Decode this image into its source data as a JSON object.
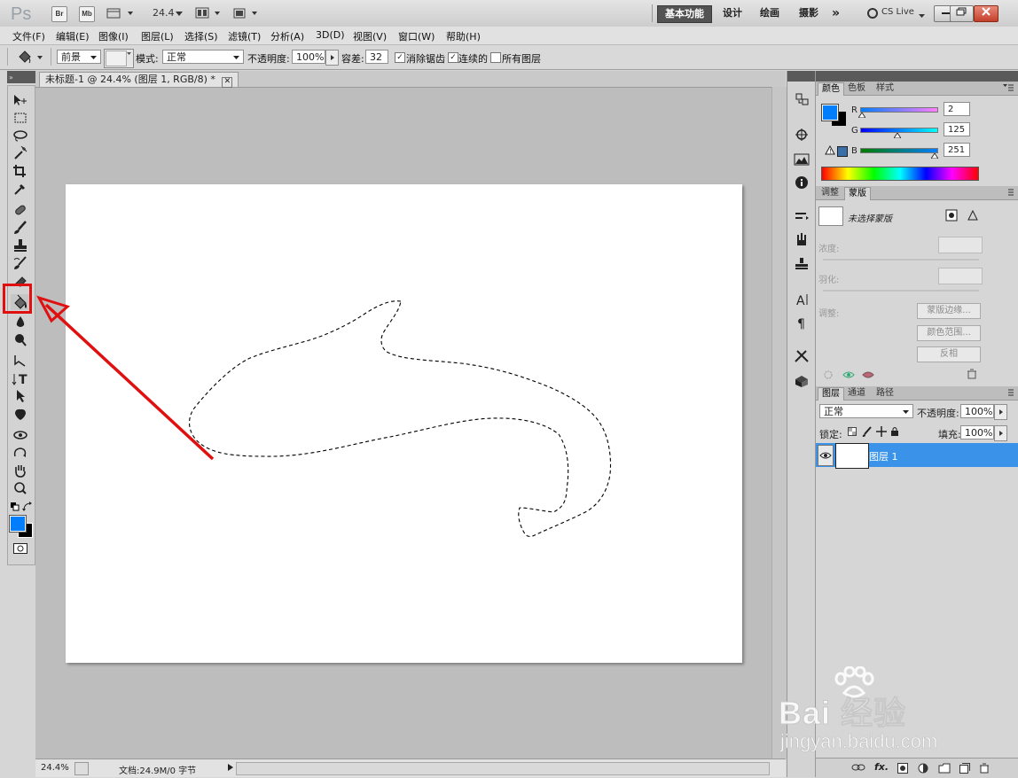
{
  "app": {
    "logo": "Ps",
    "bridge_btn": "Br",
    "mini_bridge_btn": "Mb",
    "zoom_value": "24.4",
    "workspaces": [
      "基本功能",
      "设计",
      "绘画",
      "摄影"
    ],
    "more_ws": "»",
    "cs_live": "CS Live"
  },
  "menu": [
    "文件(F)",
    "编辑(E)",
    "图像(I)",
    "图层(L)",
    "选择(S)",
    "滤镜(T)",
    "分析(A)",
    "3D(D)",
    "视图(V)",
    "窗口(W)",
    "帮助(H)"
  ],
  "options": {
    "fill_source": "前景",
    "mode_label": "模式:",
    "mode_value": "正常",
    "opacity_label": "不透明度:",
    "opacity_value": "100%",
    "tolerance_label": "容差:",
    "tolerance_value": "32",
    "antialias_label": "消除锯齿",
    "contiguous_label": "连续的",
    "all_layers_label": "所有图层"
  },
  "document": {
    "tab_title": "未标题-1 @ 24.4% (图层 1, RGB/8) *",
    "status_zoom": "24.4%",
    "status_doc": "文档:24.9M/0 字节"
  },
  "color_panel": {
    "tabs": [
      "颜色",
      "色板",
      "样式"
    ],
    "r_label": "R",
    "g_label": "G",
    "b_label": "B",
    "r": "2",
    "g": "125",
    "b": "251",
    "fg_color": "#027dfb"
  },
  "masks_panel": {
    "tabs": [
      "调整",
      "蒙版"
    ],
    "no_selection": "未选择蒙版",
    "density_label": "浓度:",
    "feather_label": "羽化:",
    "refine_label": "调整:",
    "mask_edge_btn": "蒙版边缘...",
    "color_range_btn": "颜色范围...",
    "invert_btn": "反相"
  },
  "layers_panel": {
    "tabs": [
      "图层",
      "通道",
      "路径"
    ],
    "blend_mode": "正常",
    "opacity_label": "不透明度:",
    "opacity_value": "100%",
    "lock_label": "锁定:",
    "fill_label": "填充:",
    "fill_value": "100%",
    "layer_name": "图层 1"
  },
  "watermark": {
    "brand": "Bai 经验",
    "url": "jingyan.baidu.com"
  },
  "colors": {
    "accent_blue": "#3a93e8",
    "highlight_red": "#e01010"
  }
}
